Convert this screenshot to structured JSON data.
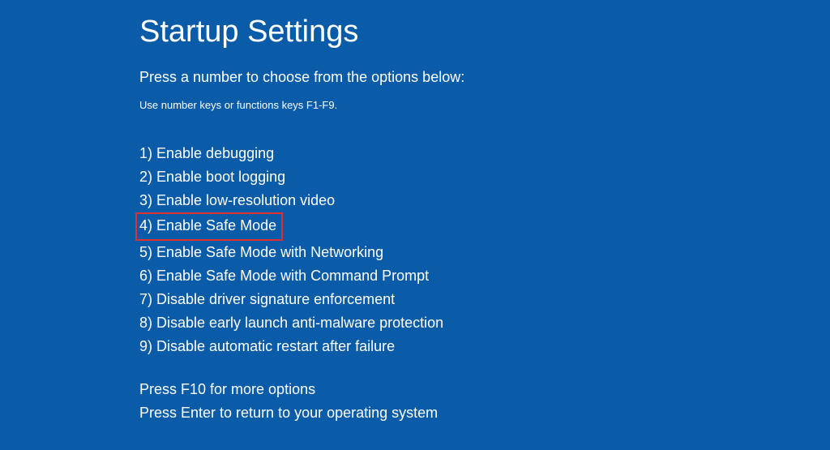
{
  "title": "Startup Settings",
  "instruction": "Press a number to choose from the options below:",
  "hint": "Use number keys or functions keys F1-F9.",
  "options": [
    {
      "label": "1) Enable debugging",
      "highlighted": false
    },
    {
      "label": "2) Enable boot logging",
      "highlighted": false
    },
    {
      "label": "3) Enable low-resolution video",
      "highlighted": false
    },
    {
      "label": "4) Enable Safe Mode",
      "highlighted": true
    },
    {
      "label": "5) Enable Safe Mode with Networking",
      "highlighted": false
    },
    {
      "label": "6) Enable Safe Mode with Command Prompt",
      "highlighted": false
    },
    {
      "label": "7) Disable driver signature enforcement",
      "highlighted": false
    },
    {
      "label": "8) Disable early launch anti-malware protection",
      "highlighted": false
    },
    {
      "label": "9) Disable automatic restart after failure",
      "highlighted": false
    }
  ],
  "footer": {
    "line1": "Press F10 for more options",
    "line2": "Press Enter to return to your operating system"
  },
  "colors": {
    "background": "#0b5ca8",
    "text": "#ffffff",
    "highlight_border": "#e03030"
  }
}
